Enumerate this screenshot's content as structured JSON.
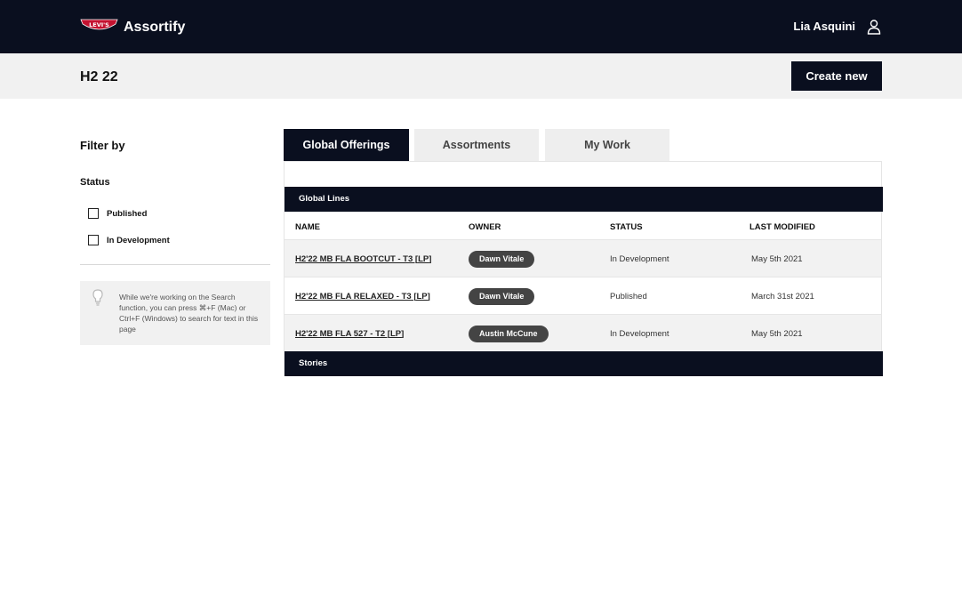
{
  "header": {
    "brand_logo_text": "Levi's",
    "app_title": "Assortify",
    "user_name": "Lia Asquini",
    "user_icon": "user-icon"
  },
  "subheader": {
    "season": "H2 22",
    "create_label": "Create new"
  },
  "filters": {
    "title": "Filter by",
    "status_label": "Status",
    "options": [
      {
        "label": "Published",
        "checked": false
      },
      {
        "label": "In Development",
        "checked": false
      }
    ],
    "tip_icon": "lightbulb-icon",
    "tip": "While we're working on the Search function, you can press ⌘+F (Mac) or Ctrl+F (Windows) to search for text in this page"
  },
  "tabs": [
    {
      "label": "Global Offerings",
      "active": true
    },
    {
      "label": "Assortments",
      "active": false
    },
    {
      "label": "My Work",
      "active": false
    }
  ],
  "sections": {
    "global_lines": "Global Lines",
    "stories": "Stories"
  },
  "table": {
    "columns": [
      "NAME",
      "OWNER",
      "STATUS",
      "LAST MODIFIED"
    ],
    "rows": [
      {
        "name": "H2'22 MB FLA BOOTCUT - T3 [LP]",
        "owner": "Dawn Vitale",
        "status": "In Development",
        "modified": "May 5th 2021"
      },
      {
        "name": "H2'22 MB FLA RELAXED - T3 [LP]",
        "owner": "Dawn Vitale",
        "status": "Published",
        "modified": "March 31st 2021"
      },
      {
        "name": "H2'22 MB FLA 527 - T2 [LP]",
        "owner": "Austin McCune",
        "status": "In Development",
        "modified": "May 5th 2021"
      }
    ]
  },
  "colors": {
    "navy": "#0a0f1f",
    "brand_red": "#c41230",
    "pill": "#444444"
  }
}
